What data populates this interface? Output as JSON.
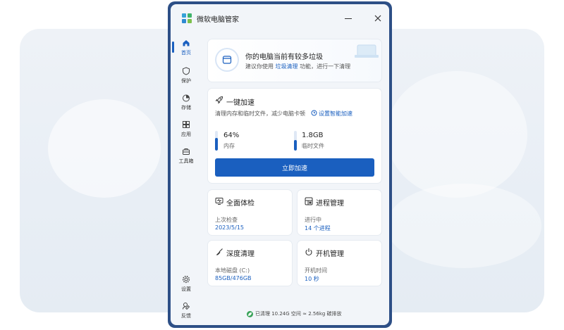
{
  "app": {
    "title": "微软电脑管家"
  },
  "colors": {
    "accent": "#1a5fbf",
    "window_border": "#2d4f86",
    "eco_green": "#3aa35a"
  },
  "sidebar": {
    "items": [
      {
        "label": "首页",
        "icon": "home-icon",
        "active": true
      },
      {
        "label": "保护",
        "icon": "shield-icon",
        "active": false
      },
      {
        "label": "存储",
        "icon": "pie-chart-icon",
        "active": false
      },
      {
        "label": "应用",
        "icon": "apps-icon",
        "active": false
      },
      {
        "label": "工具箱",
        "icon": "toolbox-icon",
        "active": false
      }
    ],
    "bottom_items": [
      {
        "label": "设置",
        "icon": "gear-icon"
      },
      {
        "label": "反馈",
        "icon": "feedback-icon"
      }
    ]
  },
  "hero": {
    "title": "你的电脑当前有较多垃圾",
    "sub_before": "建议你使用",
    "sub_link": "垃圾清理",
    "sub_after": "功能，进行一下清理"
  },
  "boost": {
    "title": "一键加速",
    "subtitle": "清理内存和临时文件，减少电脑卡顿",
    "settings_link": "设置智能加速",
    "memory": {
      "value": "64%",
      "label": "内存",
      "level": 0.64
    },
    "temp": {
      "value": "1.8GB",
      "label": "临时文件",
      "level": 0.55
    },
    "button": "立即加速"
  },
  "tiles": [
    {
      "title": "全面体检",
      "icon": "monitor-check-icon",
      "label": "上次检查",
      "value": "2023/5/15"
    },
    {
      "title": "进程管理",
      "icon": "process-icon",
      "label": "进行中",
      "value": "14 个进程"
    },
    {
      "title": "深度清理",
      "icon": "broom-icon",
      "label": "本地磁盘 (C:)",
      "value": "85GB/476GB"
    },
    {
      "title": "开机管理",
      "icon": "power-icon",
      "label": "开机时间",
      "value": "10 秒"
    }
  ],
  "footer": {
    "text": "已清理 10.24G 空间 ≈ 2.56kg 碳排放"
  }
}
